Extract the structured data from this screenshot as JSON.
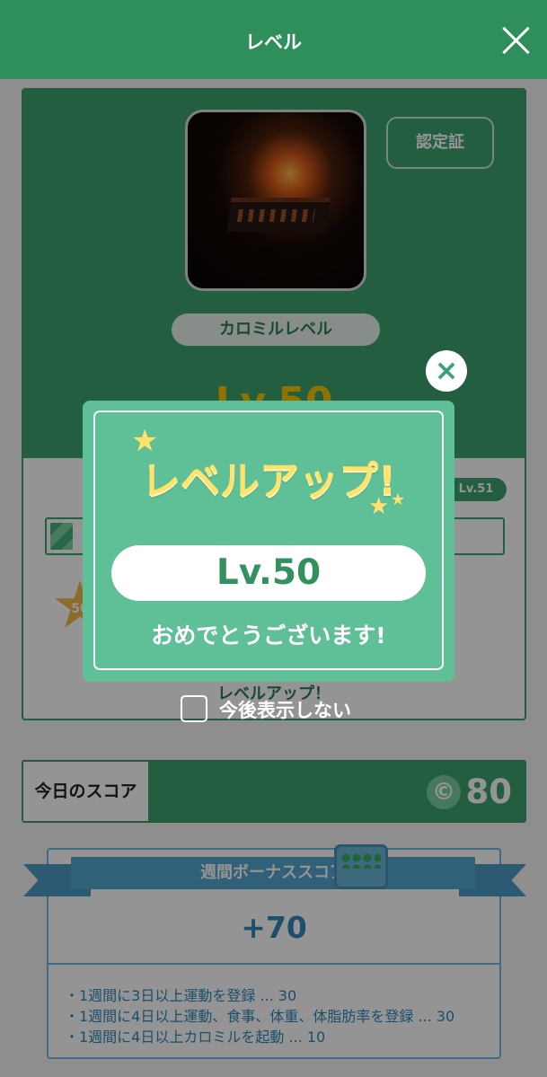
{
  "header": {
    "title": "レベル"
  },
  "level_card": {
    "certificate": "認定証",
    "level_name": "カロミルレベル",
    "current_level": "Lv.50",
    "next_level": "Lv.51",
    "progress": 0.05,
    "medal_number": "50",
    "status": "レベルアップ！"
  },
  "score": {
    "label": "今日のスコア",
    "value": "80"
  },
  "bonus": {
    "title": "週間ボーナススコア",
    "value": "+70",
    "rules": [
      "・1週間に3日以上運動を登録 ... 30",
      "・1週間に4日以上運動、食事、体重、体脂肪率を登録 ... 30",
      "・1週間に4日以上カロミルを起動 ... 10"
    ]
  },
  "modal": {
    "title": "レベルアップ!",
    "level": "Lv.50",
    "message": "おめでとうございます!",
    "checkbox_label": "今後表示しない"
  },
  "colors": {
    "green": "#3fa371",
    "blue": "#55a7d1",
    "gold": "#ffe36c"
  }
}
